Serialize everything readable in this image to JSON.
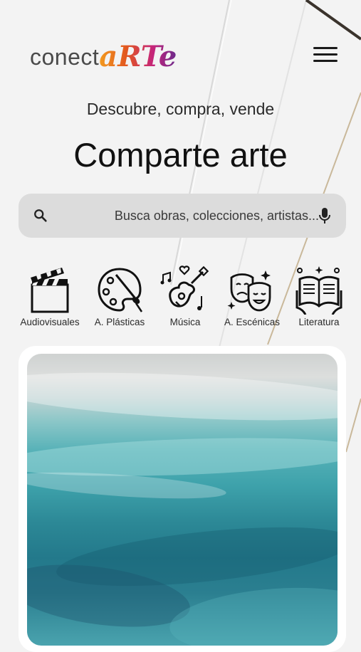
{
  "brand": {
    "logo_prefix": "conect",
    "logo_accent": "aRTe"
  },
  "hero": {
    "subtitle": "Descubre, compra, vende",
    "title": "Comparte arte"
  },
  "search": {
    "placeholder": "Busca obras, colecciones, artistas...",
    "value": ""
  },
  "categories": [
    {
      "label": "Audiovisuales",
      "icon": "clapperboard-icon"
    },
    {
      "label": "A. Plásticas",
      "icon": "palette-icon"
    },
    {
      "label": "Música",
      "icon": "guitar-icon"
    },
    {
      "label": "A. Escénicas",
      "icon": "theater-masks-icon"
    },
    {
      "label": "Literatura",
      "icon": "open-book-icon"
    }
  ],
  "featured": {
    "image": "turquoise-abstract-painting"
  },
  "colors": {
    "background": "#f3f3f3",
    "search_bg": "#dcdcdc",
    "logo_gradient": [
      "#f39b1f",
      "#e2571f",
      "#c4247b",
      "#6b2a8c"
    ]
  }
}
